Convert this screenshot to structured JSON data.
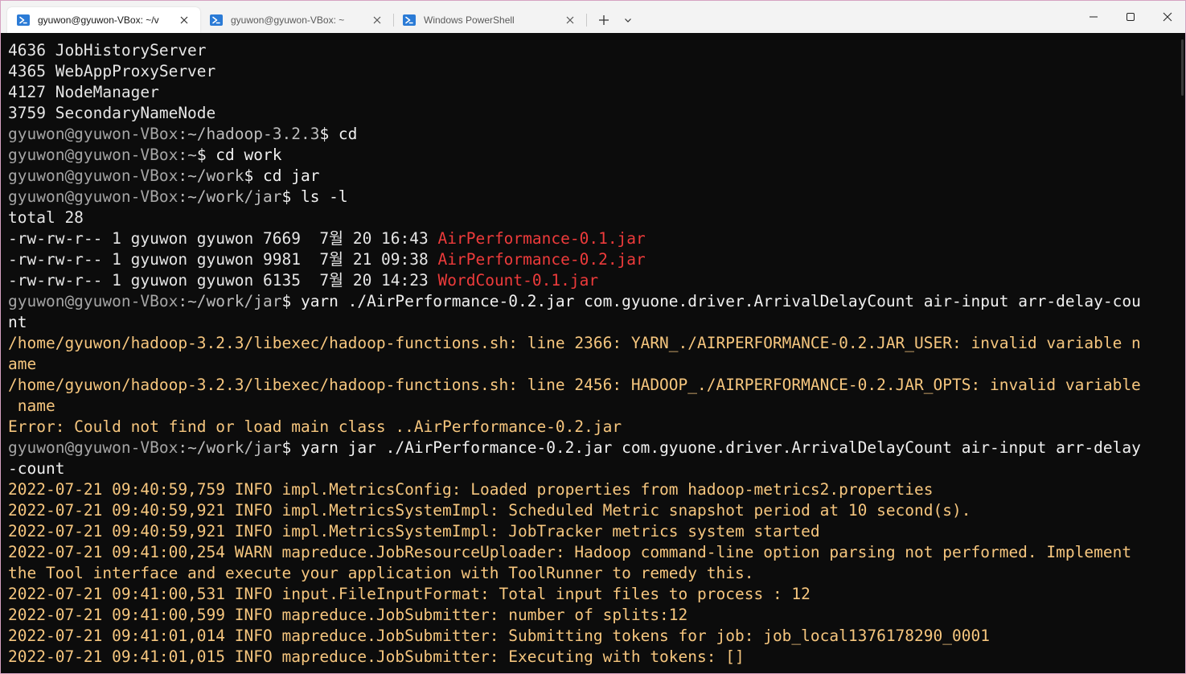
{
  "window": {
    "tabs": [
      {
        "label": "gyuwon@gyuwon-VBox: ~/v",
        "active": true
      },
      {
        "label": "gyuwon@gyuwon-VBox: ~",
        "active": false
      },
      {
        "label": "Windows PowerShell",
        "active": false
      }
    ],
    "new_tab_icon": "plus-icon",
    "dropdown_icon": "chevron-down-icon",
    "controls": [
      "minimize-icon",
      "maximize-icon",
      "close-icon"
    ]
  },
  "colors": {
    "background": "#0c0c0c",
    "prompt_user": "#a5a5a5",
    "jar_file_red": "#ee3b3b",
    "log_yellow": "#f6c67e",
    "tab_icon_blue": "#2b7bd6"
  },
  "terminal": {
    "lines": [
      [
        {
          "t": "4636 JobHistoryServer",
          "c": "out"
        }
      ],
      [
        {
          "t": "4365 WebAppProxyServer",
          "c": "out"
        }
      ],
      [
        {
          "t": "4127 NodeManager",
          "c": "out"
        }
      ],
      [
        {
          "t": "3759 SecondaryNameNode",
          "c": "out"
        }
      ],
      [
        {
          "t": "gyuwon@gyuwon-VBox",
          "c": "user"
        },
        {
          "t": ":~/hadoop-3.2.3",
          "c": "path"
        },
        {
          "t": "$ cd",
          "c": "cmd"
        }
      ],
      [
        {
          "t": "gyuwon@gyuwon-VBox",
          "c": "user"
        },
        {
          "t": ":~",
          "c": "path"
        },
        {
          "t": "$ cd work",
          "c": "cmd"
        }
      ],
      [
        {
          "t": "gyuwon@gyuwon-VBox",
          "c": "user"
        },
        {
          "t": ":~/work",
          "c": "path"
        },
        {
          "t": "$ cd jar",
          "c": "cmd"
        }
      ],
      [
        {
          "t": "gyuwon@gyuwon-VBox",
          "c": "user"
        },
        {
          "t": ":~/work/jar",
          "c": "path"
        },
        {
          "t": "$ ls -l",
          "c": "cmd"
        }
      ],
      [
        {
          "t": "total 28",
          "c": "out"
        }
      ],
      [
        {
          "t": "-rw-rw-r-- 1 gyuwon gyuwon 7669  7월 20 16:43 ",
          "c": "out"
        },
        {
          "t": "AirPerformance-0.1.jar",
          "c": "red"
        }
      ],
      [
        {
          "t": "-rw-rw-r-- 1 gyuwon gyuwon 9981  7월 21 09:38 ",
          "c": "out"
        },
        {
          "t": "AirPerformance-0.2.jar",
          "c": "red"
        }
      ],
      [
        {
          "t": "-rw-rw-r-- 1 gyuwon gyuwon 6135  7월 20 14:23 ",
          "c": "out"
        },
        {
          "t": "WordCount-0.1.jar",
          "c": "red"
        }
      ],
      [
        {
          "t": "gyuwon@gyuwon-VBox",
          "c": "user"
        },
        {
          "t": ":~/work/jar",
          "c": "path"
        },
        {
          "t": "$ yarn ./AirPerformance-0.2.jar com.gyuone.driver.ArrivalDelayCount air-input arr-delay-cou",
          "c": "cmd"
        }
      ],
      [
        {
          "t": "nt",
          "c": "cmd"
        }
      ],
      [
        {
          "t": "/home/gyuwon/hadoop-3.2.3/libexec/hadoop-functions.sh: line 2366: YARN_./AIRPERFORMANCE-0.2.JAR_USER: invalid variable n",
          "c": "yel"
        }
      ],
      [
        {
          "t": "ame",
          "c": "yel"
        }
      ],
      [
        {
          "t": "/home/gyuwon/hadoop-3.2.3/libexec/hadoop-functions.sh: line 2456: HADOOP_./AIRPERFORMANCE-0.2.JAR_OPTS: invalid variable",
          "c": "yel"
        }
      ],
      [
        {
          "t": " name",
          "c": "yel"
        }
      ],
      [
        {
          "t": "Error: Could not find or load main class ..AirPerformance-0.2.jar",
          "c": "yel"
        }
      ],
      [
        {
          "t": "gyuwon@gyuwon-VBox",
          "c": "user"
        },
        {
          "t": ":~/work/jar",
          "c": "path"
        },
        {
          "t": "$ yarn jar ./AirPerformance-0.2.jar com.gyuone.driver.ArrivalDelayCount air-input arr-delay",
          "c": "cmd"
        }
      ],
      [
        {
          "t": "-count",
          "c": "cmd"
        }
      ],
      [
        {
          "t": "2022-07-21 09:40:59,759 INFO impl.MetricsConfig: Loaded properties from hadoop-metrics2.properties",
          "c": "yel"
        }
      ],
      [
        {
          "t": "2022-07-21 09:40:59,921 INFO impl.MetricsSystemImpl: Scheduled Metric snapshot period at 10 second(s).",
          "c": "yel"
        }
      ],
      [
        {
          "t": "2022-07-21 09:40:59,921 INFO impl.MetricsSystemImpl: JobTracker metrics system started",
          "c": "yel"
        }
      ],
      [
        {
          "t": "2022-07-21 09:41:00,254 WARN mapreduce.JobResourceUploader: Hadoop command-line option parsing not performed. Implement",
          "c": "yel"
        }
      ],
      [
        {
          "t": "the Tool interface and execute your application with ToolRunner to remedy this.",
          "c": "yel"
        }
      ],
      [
        {
          "t": "2022-07-21 09:41:00,531 INFO input.FileInputFormat: Total input files to process : 12",
          "c": "yel"
        }
      ],
      [
        {
          "t": "2022-07-21 09:41:00,599 INFO mapreduce.JobSubmitter: number of splits:12",
          "c": "yel"
        }
      ],
      [
        {
          "t": "2022-07-21 09:41:01,014 INFO mapreduce.JobSubmitter: Submitting tokens for job: job_local1376178290_0001",
          "c": "yel"
        }
      ],
      [
        {
          "t": "2022-07-21 09:41:01,015 INFO mapreduce.JobSubmitter: Executing with tokens: []",
          "c": "yel"
        }
      ]
    ]
  }
}
